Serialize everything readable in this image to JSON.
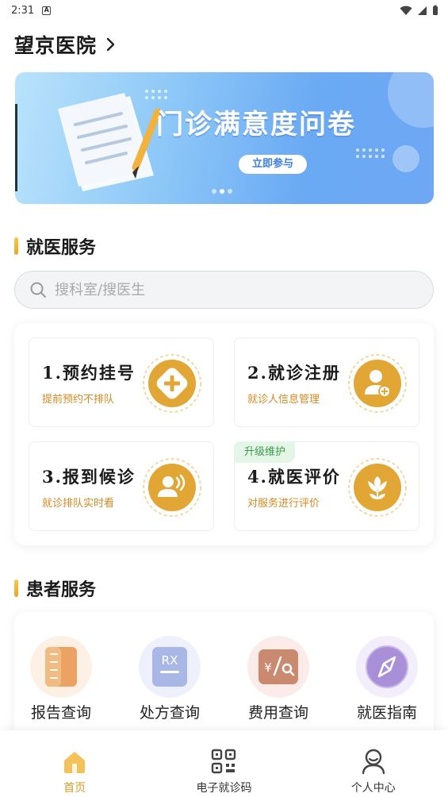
{
  "status_bar": {
    "time": "2:31",
    "notification_icon": "a-icon",
    "battery_icon": "battery-icon",
    "wifi_icon": "wifi-icon",
    "signal_icon": "signal-icon"
  },
  "header": {
    "hospital_name": "望京医院",
    "chevron_icon": "chevron-right-icon"
  },
  "banner": {
    "title": "门诊满意度问卷",
    "cta": "立即参与",
    "slide_count": 3,
    "active_slide": 2
  },
  "medical_services": {
    "title": "就医服务",
    "search_placeholder": "搜科室/搜医生",
    "cards": [
      {
        "title": "1.预约挂号",
        "subtitle": "提前预约不排队",
        "icon": "plus-icon",
        "badge": ""
      },
      {
        "title": "2.就诊注册",
        "subtitle": "就诊人信息管理",
        "icon": "user-add-icon",
        "badge": ""
      },
      {
        "title": "3.报到候诊",
        "subtitle": "就诊排队实时看",
        "icon": "users-wave-icon",
        "badge": ""
      },
      {
        "title": "4.就医评价",
        "subtitle": "对服务进行评价",
        "icon": "flower-icon",
        "badge": "升级维护"
      }
    ]
  },
  "patient_services": {
    "title": "患者服务",
    "items": [
      {
        "label": "报告查询",
        "icon": "report-icon"
      },
      {
        "label": "处方查询",
        "icon": "rx-icon"
      },
      {
        "label": "费用查询",
        "icon": "fee-search-icon"
      },
      {
        "label": "就医指南",
        "icon": "compass-icon"
      }
    ]
  },
  "tab_bar": {
    "tabs": [
      {
        "label": "首页",
        "icon": "home-icon",
        "active": true
      },
      {
        "label": "电子就诊码",
        "icon": "qr-code-icon",
        "active": false
      },
      {
        "label": "个人中心",
        "icon": "person-icon",
        "active": false
      }
    ]
  },
  "colors": {
    "accent": "#d99a2b",
    "gold": "#e0a030",
    "badge_green": "#3d9b4a",
    "banner_blue": "#6aa9f3"
  }
}
